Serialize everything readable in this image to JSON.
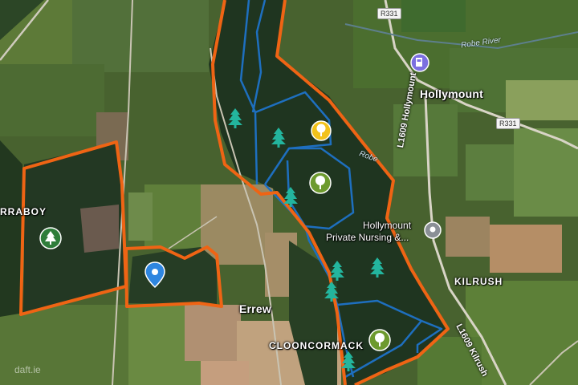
{
  "places": {
    "hollymount": "Hollymount",
    "errew": "Errew",
    "kilrush": "KILRUSH",
    "clooncormack": "CLOONCORMACK",
    "carraboy": "RRABOY"
  },
  "poi": {
    "nursing_line1": "Hollymount",
    "nursing_line2": "Private Nursing &..."
  },
  "roads": {
    "r331_top": "R331",
    "r331_right": "R331",
    "l1609_hollymount": "L1609 Hollymount",
    "l1609_kilrush": "L1609 Kilrush"
  },
  "rivers": {
    "robe_river": "Robe River",
    "robe_short": "Robe"
  },
  "watermark": "daft.ie",
  "colors": {
    "boundary": "#ef6414",
    "compartment": "#1e6fbf",
    "tree_teal": "#23b59e",
    "tree_green_badge": "#2f7d3a",
    "oak_badge": "#6d9a2e",
    "yellow_badge": "#f2c21b",
    "pin_blue": "#2e86e0",
    "fuel_purple": "#7b6fe0"
  },
  "icons": {
    "tree": "conifer-tree-icon",
    "deciduous": "deciduous-tree-icon",
    "pin": "location-pin-icon",
    "fuel": "fuel-station-icon",
    "poi": "poi-marker-icon"
  }
}
